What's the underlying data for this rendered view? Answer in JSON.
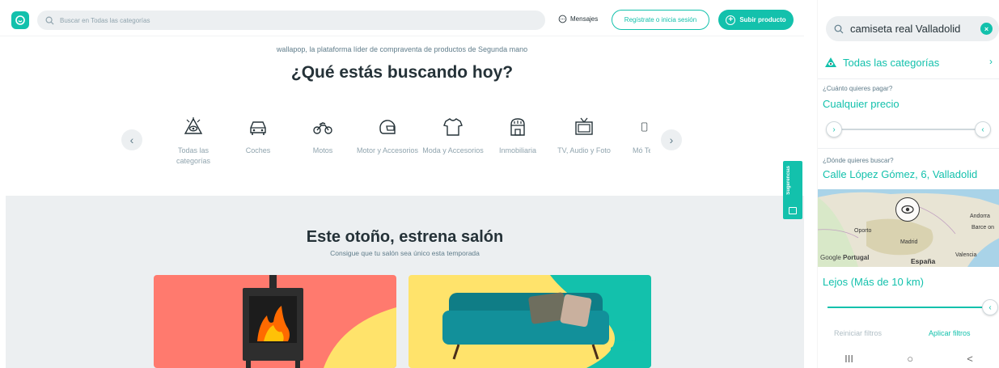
{
  "colors": {
    "brand": "#13c1ac",
    "text": "#253238",
    "muted": "#90a4ae",
    "background_gray": "#eceff1"
  },
  "header": {
    "search_placeholder": "Buscar en Todas las categorías",
    "messages_label": "Mensajes",
    "login_label": "Regístrate o inicia sesión",
    "upload_label": "Subir producto"
  },
  "hero": {
    "tagline": "wallapop, la plataforma líder de compraventa de productos de Segunda mano",
    "title": "¿Qué estás buscando hoy?"
  },
  "categories": [
    {
      "label": "Todas las categorías",
      "icon": "all-categories-icon"
    },
    {
      "label": "Coches",
      "icon": "car-icon"
    },
    {
      "label": "Motos",
      "icon": "motorbike-icon"
    },
    {
      "label": "Motor y Accesorios",
      "icon": "helmet-icon"
    },
    {
      "label": "Moda y Accesorios",
      "icon": "tshirt-icon"
    },
    {
      "label": "Inmobiliaria",
      "icon": "house-icon"
    },
    {
      "label": "TV, Audio y Foto",
      "icon": "tv-icon"
    },
    {
      "label": "Mó Tel",
      "icon": "phone-icon"
    }
  ],
  "promo": {
    "title": "Este otoño, estrena salón",
    "subtitle": "Consigue que tu salón sea único esta temporada"
  },
  "feedback_tab": {
    "label": "Sugerencias"
  },
  "mobile": {
    "search_query": "camiseta real Valladolid",
    "all_categories": "Todas las categorías",
    "price_question": "¿Cuánto quieres pagar?",
    "price_value": "Cualquier precio",
    "location_question": "¿Dónde quieres buscar?",
    "location_value": "Calle López Gómez, 6, Valladolid",
    "map_labels": {
      "andorra": "Andorra",
      "barcelona": "Barce on",
      "oporto": "Oporto",
      "madrid": "Madrid",
      "portugal": "Portugal",
      "espana": "España",
      "valencia": "Valencia",
      "google": "Google"
    },
    "distance_value": "Lejos (Más de 10 km)",
    "reset_label": "Reiniciar filtros",
    "apply_label": "Aplicar filtros",
    "nav": {
      "recents": "III",
      "home": "○",
      "back": "<"
    }
  }
}
